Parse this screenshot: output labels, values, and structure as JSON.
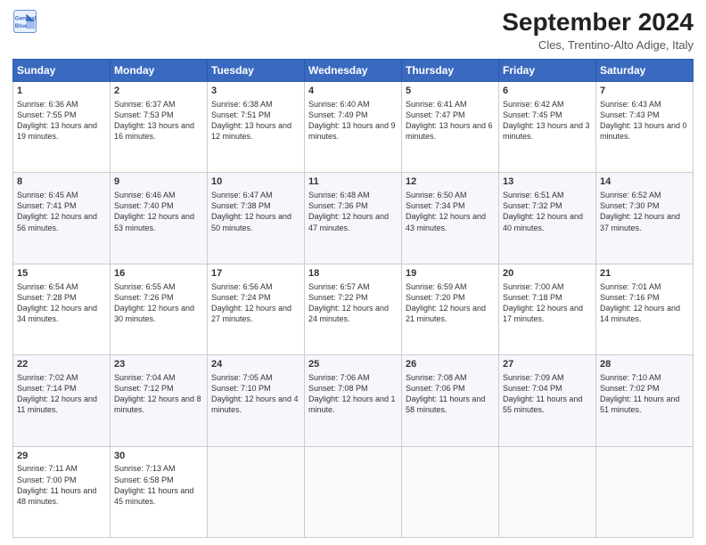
{
  "logo": {
    "line1": "General",
    "line2": "Blue"
  },
  "header": {
    "month": "September 2024",
    "location": "Cles, Trentino-Alto Adige, Italy"
  },
  "days": [
    "Sunday",
    "Monday",
    "Tuesday",
    "Wednesday",
    "Thursday",
    "Friday",
    "Saturday"
  ],
  "weeks": [
    [
      {
        "day": "1",
        "sunrise": "6:36 AM",
        "sunset": "7:55 PM",
        "daylight": "13 hours and 19 minutes."
      },
      {
        "day": "2",
        "sunrise": "6:37 AM",
        "sunset": "7:53 PM",
        "daylight": "13 hours and 16 minutes."
      },
      {
        "day": "3",
        "sunrise": "6:38 AM",
        "sunset": "7:51 PM",
        "daylight": "13 hours and 12 minutes."
      },
      {
        "day": "4",
        "sunrise": "6:40 AM",
        "sunset": "7:49 PM",
        "daylight": "13 hours and 9 minutes."
      },
      {
        "day": "5",
        "sunrise": "6:41 AM",
        "sunset": "7:47 PM",
        "daylight": "13 hours and 6 minutes."
      },
      {
        "day": "6",
        "sunrise": "6:42 AM",
        "sunset": "7:45 PM",
        "daylight": "13 hours and 3 minutes."
      },
      {
        "day": "7",
        "sunrise": "6:43 AM",
        "sunset": "7:43 PM",
        "daylight": "13 hours and 0 minutes."
      }
    ],
    [
      {
        "day": "8",
        "sunrise": "6:45 AM",
        "sunset": "7:41 PM",
        "daylight": "12 hours and 56 minutes."
      },
      {
        "day": "9",
        "sunrise": "6:46 AM",
        "sunset": "7:40 PM",
        "daylight": "12 hours and 53 minutes."
      },
      {
        "day": "10",
        "sunrise": "6:47 AM",
        "sunset": "7:38 PM",
        "daylight": "12 hours and 50 minutes."
      },
      {
        "day": "11",
        "sunrise": "6:48 AM",
        "sunset": "7:36 PM",
        "daylight": "12 hours and 47 minutes."
      },
      {
        "day": "12",
        "sunrise": "6:50 AM",
        "sunset": "7:34 PM",
        "daylight": "12 hours and 43 minutes."
      },
      {
        "day": "13",
        "sunrise": "6:51 AM",
        "sunset": "7:32 PM",
        "daylight": "12 hours and 40 minutes."
      },
      {
        "day": "14",
        "sunrise": "6:52 AM",
        "sunset": "7:30 PM",
        "daylight": "12 hours and 37 minutes."
      }
    ],
    [
      {
        "day": "15",
        "sunrise": "6:54 AM",
        "sunset": "7:28 PM",
        "daylight": "12 hours and 34 minutes."
      },
      {
        "day": "16",
        "sunrise": "6:55 AM",
        "sunset": "7:26 PM",
        "daylight": "12 hours and 30 minutes."
      },
      {
        "day": "17",
        "sunrise": "6:56 AM",
        "sunset": "7:24 PM",
        "daylight": "12 hours and 27 minutes."
      },
      {
        "day": "18",
        "sunrise": "6:57 AM",
        "sunset": "7:22 PM",
        "daylight": "12 hours and 24 minutes."
      },
      {
        "day": "19",
        "sunrise": "6:59 AM",
        "sunset": "7:20 PM",
        "daylight": "12 hours and 21 minutes."
      },
      {
        "day": "20",
        "sunrise": "7:00 AM",
        "sunset": "7:18 PM",
        "daylight": "12 hours and 17 minutes."
      },
      {
        "day": "21",
        "sunrise": "7:01 AM",
        "sunset": "7:16 PM",
        "daylight": "12 hours and 14 minutes."
      }
    ],
    [
      {
        "day": "22",
        "sunrise": "7:02 AM",
        "sunset": "7:14 PM",
        "daylight": "12 hours and 11 minutes."
      },
      {
        "day": "23",
        "sunrise": "7:04 AM",
        "sunset": "7:12 PM",
        "daylight": "12 hours and 8 minutes."
      },
      {
        "day": "24",
        "sunrise": "7:05 AM",
        "sunset": "7:10 PM",
        "daylight": "12 hours and 4 minutes."
      },
      {
        "day": "25",
        "sunrise": "7:06 AM",
        "sunset": "7:08 PM",
        "daylight": "12 hours and 1 minute."
      },
      {
        "day": "26",
        "sunrise": "7:08 AM",
        "sunset": "7:06 PM",
        "daylight": "11 hours and 58 minutes."
      },
      {
        "day": "27",
        "sunrise": "7:09 AM",
        "sunset": "7:04 PM",
        "daylight": "11 hours and 55 minutes."
      },
      {
        "day": "28",
        "sunrise": "7:10 AM",
        "sunset": "7:02 PM",
        "daylight": "11 hours and 51 minutes."
      }
    ],
    [
      {
        "day": "29",
        "sunrise": "7:11 AM",
        "sunset": "7:00 PM",
        "daylight": "11 hours and 48 minutes."
      },
      {
        "day": "30",
        "sunrise": "7:13 AM",
        "sunset": "6:58 PM",
        "daylight": "11 hours and 45 minutes."
      },
      null,
      null,
      null,
      null,
      null
    ]
  ]
}
